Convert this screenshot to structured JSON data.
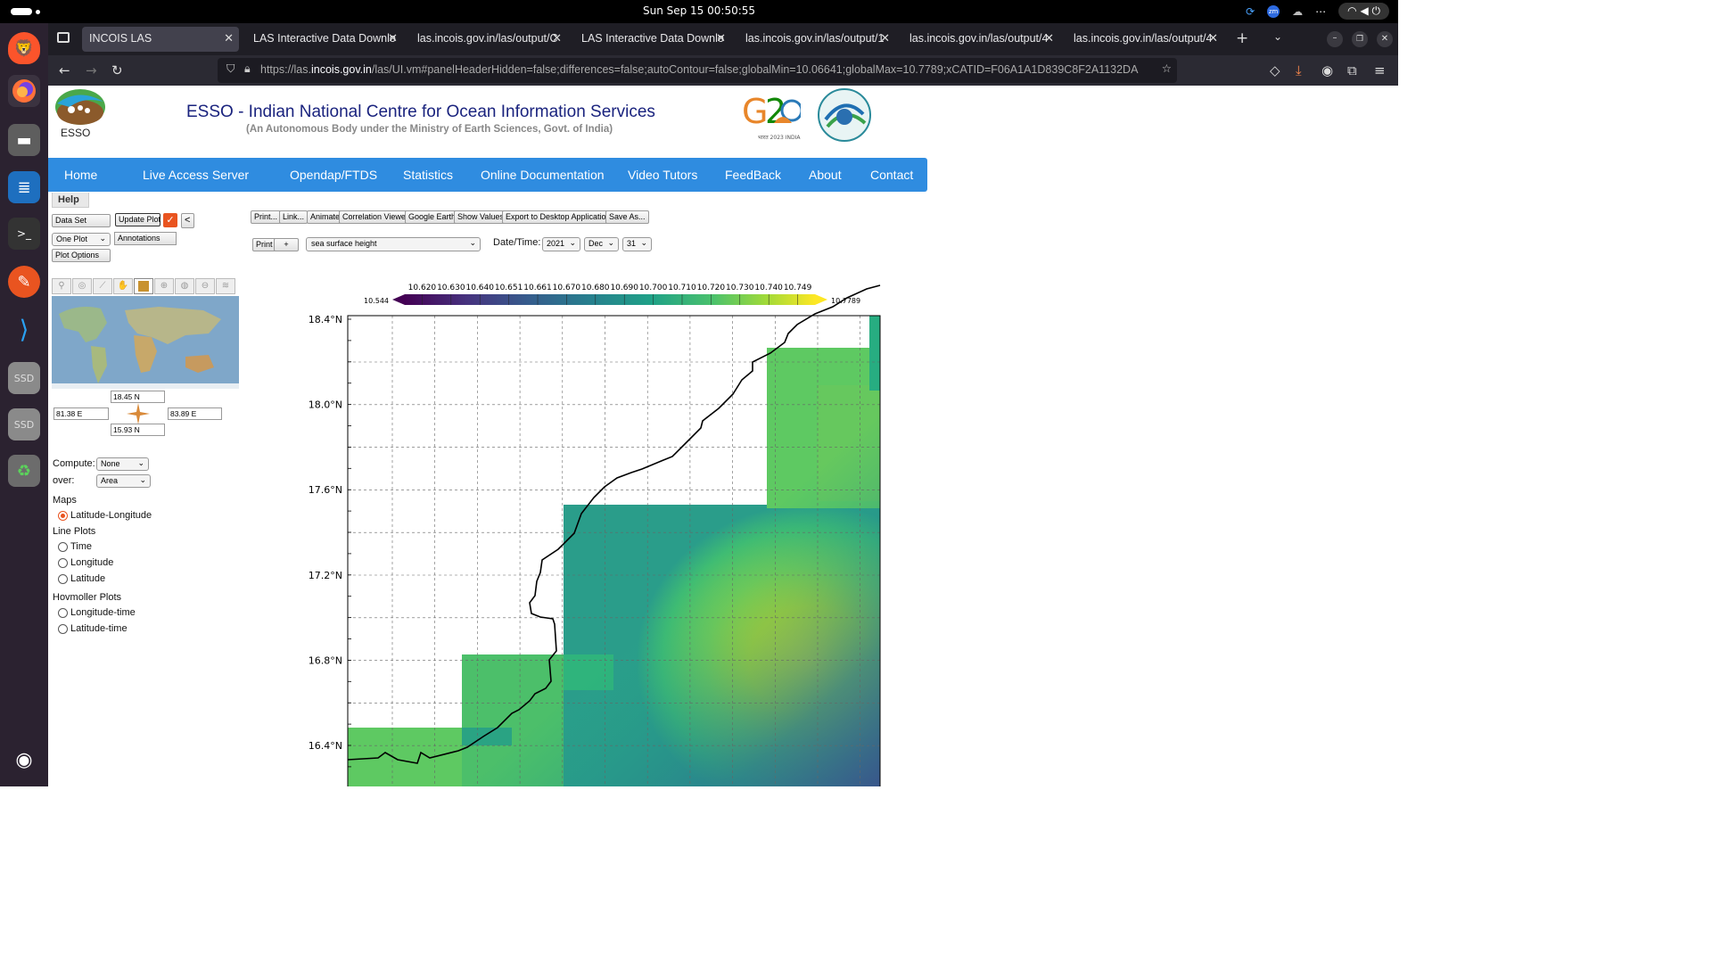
{
  "os": {
    "clock": "Sun Sep 15  00:50:55"
  },
  "browser": {
    "tabs": [
      {
        "label": "INCOIS LAS",
        "active": true
      },
      {
        "label": "LAS Interactive Data Downlo",
        "active": false
      },
      {
        "label": "las.incois.gov.in/las/output/C",
        "active": false
      },
      {
        "label": "LAS Interactive Data Downlo",
        "active": false
      },
      {
        "label": "las.incois.gov.in/las/output/1",
        "active": false
      },
      {
        "label": "las.incois.gov.in/las/output/4",
        "active": false
      },
      {
        "label": "las.incois.gov.in/las/output/4",
        "active": false
      }
    ],
    "url_prefix": "https://las.",
    "url_domain": "incois.gov.in",
    "url_rest": "/las/UI.vm#panelHeaderHidden=false;differences=false;autoContour=false;globalMin=10.06641;globalMax=10.7789;xCATID=F06A1A1D839C8F2A1132DA"
  },
  "header": {
    "logo_caption": "ESSO",
    "title": "ESSO - Indian National Centre for Ocean Information Services",
    "subtitle": "(An Autonomous Body under the Ministry of Earth Sciences, Govt. of India)"
  },
  "menu": [
    "Home",
    "Live Access Server",
    "Opendap/FTDS",
    "Statistics",
    "Online Documentation",
    "Video Tutors",
    "FeedBack",
    "About",
    "Contact"
  ],
  "left": {
    "help": "Help",
    "data_set": "Data Set",
    "update_plot": "Update Plot",
    "collapse": "<",
    "one_plot": "One Plot",
    "annotations": "Annotations",
    "plot_options": "Plot Options",
    "north": "18.45 N",
    "south": "15.93 N",
    "west": "81.38 E",
    "east": "83.89 E",
    "compute_label": "Compute:",
    "compute_value": "None",
    "over_label": "over:",
    "over_value": "Area",
    "maps_heading": "Maps",
    "maps_options": [
      {
        "label": "Latitude-Longitude",
        "selected": true
      }
    ],
    "line_heading": "Line Plots",
    "line_options": [
      {
        "label": "Time",
        "selected": false
      },
      {
        "label": "Longitude",
        "selected": false
      },
      {
        "label": "Latitude",
        "selected": false
      }
    ],
    "hov_heading": "Hovmoller Plots",
    "hov_options": [
      {
        "label": "Longitude-time",
        "selected": false
      },
      {
        "label": "Latitude-time",
        "selected": false
      }
    ]
  },
  "toolbar": [
    "Print...",
    "Link...",
    "Animate",
    "Correlation Viewer",
    "Google Earth",
    "Show Values",
    "Export to Desktop Application",
    "Save As..."
  ],
  "controls": {
    "print": "Print",
    "plus": "+",
    "variable": "sea surface height",
    "datetime_label": "Date/Time:",
    "year": "2021",
    "month": "Dec",
    "day": "31"
  },
  "chart_data": {
    "type": "heatmap",
    "title": "",
    "colorbar_ticks": [
      "10.620",
      "10.630",
      "10.640",
      "10.651",
      "10.661",
      "10.670",
      "10.680",
      "10.690",
      "10.700",
      "10.710",
      "10.720",
      "10.730",
      "10.740",
      "10.749"
    ],
    "colorbar_min": "10.544",
    "colorbar_max": "10.7789",
    "ylabels": [
      "18.4°N",
      "18.0°N",
      "17.6°N",
      "17.2°N",
      "16.8°N",
      "16.4°N"
    ],
    "lat_range": [
      15.93,
      18.45
    ],
    "lon_range": [
      81.38,
      83.89
    ],
    "colors": {
      "low": "#440154",
      "mid": "#21918c",
      "high": "#fde725"
    }
  }
}
